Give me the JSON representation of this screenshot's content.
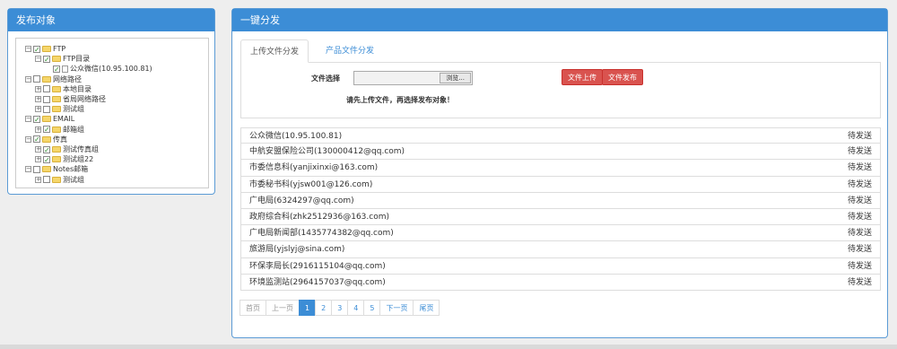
{
  "left_panel": {
    "title": "发布对象",
    "tree": [
      {
        "label": "FTP",
        "depth": 0,
        "expander": "−",
        "checked": true,
        "icon": "folder-icon"
      },
      {
        "label": "FTP目录",
        "depth": 1,
        "expander": "−",
        "checked": true,
        "icon": "folder-icon"
      },
      {
        "label": "公众微信(10.95.100.81)",
        "depth": 2,
        "expander": "",
        "checked": true,
        "icon": "file-icon"
      },
      {
        "label": "网络路径",
        "depth": 0,
        "expander": "−",
        "checked": false,
        "icon": "folder-icon"
      },
      {
        "label": "本地目录",
        "depth": 1,
        "expander": "+",
        "checked": false,
        "icon": "folder-icon"
      },
      {
        "label": "省局网络路径",
        "depth": 1,
        "expander": "+",
        "checked": false,
        "icon": "folder-icon"
      },
      {
        "label": "测试组",
        "depth": 1,
        "expander": "+",
        "checked": false,
        "icon": "folder-icon"
      },
      {
        "label": "EMAIL",
        "depth": 0,
        "expander": "−",
        "checked": true,
        "icon": "folder-icon"
      },
      {
        "label": "邮箱组",
        "depth": 1,
        "expander": "+",
        "checked": true,
        "icon": "folder-icon"
      },
      {
        "label": "传真",
        "depth": 0,
        "expander": "−",
        "checked": true,
        "icon": "folder-icon"
      },
      {
        "label": "测试传真组",
        "depth": 1,
        "expander": "+",
        "checked": true,
        "icon": "folder-icon"
      },
      {
        "label": "测试组22",
        "depth": 1,
        "expander": "+",
        "checked": true,
        "icon": "folder-icon"
      },
      {
        "label": "Notes邮箱",
        "depth": 0,
        "expander": "−",
        "checked": false,
        "icon": "folder-icon"
      },
      {
        "label": "测试组",
        "depth": 1,
        "expander": "+",
        "checked": false,
        "icon": "folder-icon"
      }
    ]
  },
  "right_panel": {
    "title": "一键分发",
    "tabs": [
      {
        "label": "上传文件分发",
        "active": true
      },
      {
        "label": "产品文件分发",
        "active": false
      }
    ],
    "upload": {
      "file_label": "文件选择",
      "browse_label": "浏览...",
      "upload_button": "文件上传",
      "publish_button": "文件发布",
      "hint": "请先上传文件，再选择发布对象！"
    },
    "list": [
      {
        "name": "公众微信(10.95.100.81)",
        "status": "待发送"
      },
      {
        "name": "中航安盟保险公司(130000412@qq.com)",
        "status": "待发送"
      },
      {
        "name": "市委信息科(yanjixinxi@163.com)",
        "status": "待发送"
      },
      {
        "name": "市委秘书科(yjsw001@126.com)",
        "status": "待发送"
      },
      {
        "name": "广电局(6324297@qq.com)",
        "status": "待发送"
      },
      {
        "name": "政府综合科(zhk2512936@163.com)",
        "status": "待发送"
      },
      {
        "name": "广电局新闻部(1435774382@qq.com)",
        "status": "待发送"
      },
      {
        "name": "旅游局(yjslyj@sina.com)",
        "status": "待发送"
      },
      {
        "name": "环保李局长(2916115104@qq.com)",
        "status": "待发送"
      },
      {
        "name": "环境监测站(2964157037@qq.com)",
        "status": "待发送"
      }
    ],
    "pagination": [
      {
        "label": "首页",
        "state": "disabled"
      },
      {
        "label": "上一页",
        "state": "disabled"
      },
      {
        "label": "1",
        "state": "active"
      },
      {
        "label": "2",
        "state": "normal"
      },
      {
        "label": "3",
        "state": "normal"
      },
      {
        "label": "4",
        "state": "normal"
      },
      {
        "label": "5",
        "state": "normal"
      },
      {
        "label": "下一页",
        "state": "normal"
      },
      {
        "label": "尾页",
        "state": "normal"
      }
    ]
  },
  "colors": {
    "header_blue": "#3c8dd6",
    "button_red": "#d9534f",
    "check_green": "#2a8a2a",
    "folder_yellow": "#f5d66b"
  }
}
